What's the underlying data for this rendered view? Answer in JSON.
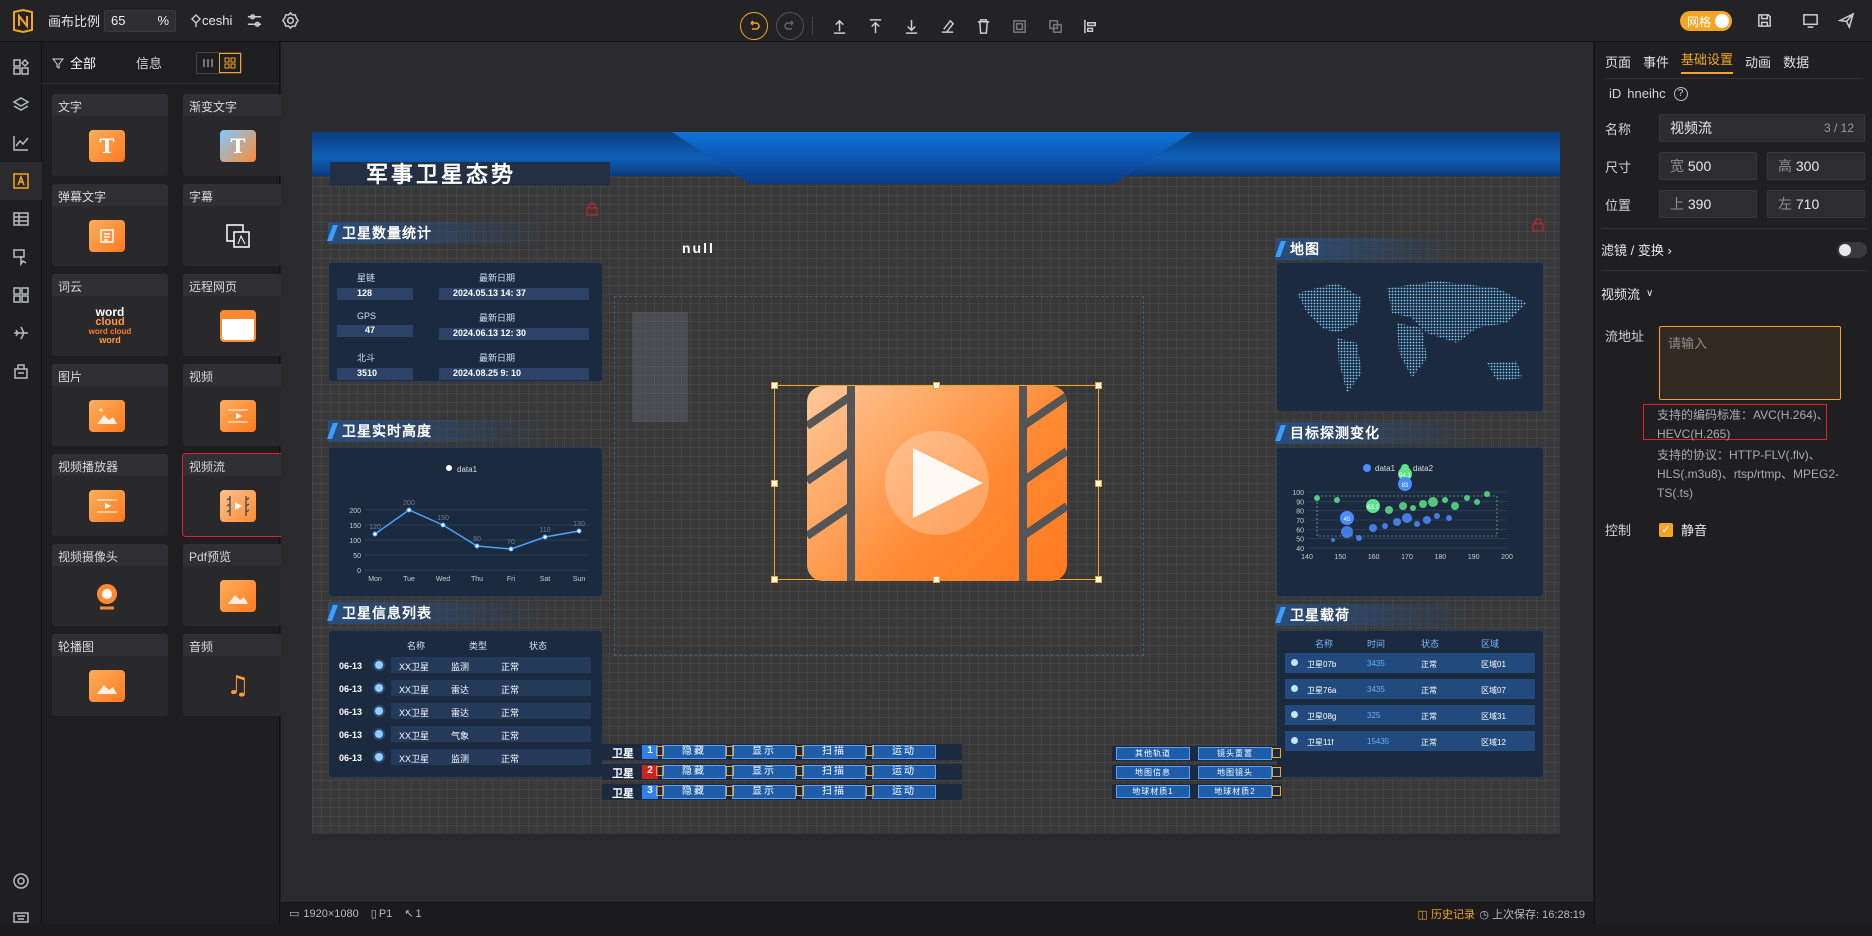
{
  "topbar": {
    "scale_label": "画布比例",
    "scale_value": "65",
    "scale_unit": "%",
    "project": "ceshi",
    "grid_label": "网格"
  },
  "panel": {
    "tab_all": "全部",
    "tab_info": "信息",
    "components": [
      {
        "label": "文字",
        "icon": "text-icon"
      },
      {
        "label": "渐变文字",
        "icon": "gradient-text-icon"
      },
      {
        "label": "弹幕文字",
        "icon": "danmaku-icon"
      },
      {
        "label": "字幕",
        "icon": "subtitle-icon"
      },
      {
        "label": "词云",
        "icon": "wordcloud-icon"
      },
      {
        "label": "远程网页",
        "icon": "webpage-icon"
      },
      {
        "label": "图片",
        "icon": "image-icon"
      },
      {
        "label": "视频",
        "icon": "video-icon"
      },
      {
        "label": "视频播放器",
        "icon": "video-player-icon"
      },
      {
        "label": "视频流",
        "icon": "video-stream-icon"
      },
      {
        "label": "视频摄像头",
        "icon": "camera-icon"
      },
      {
        "label": "Pdf预览",
        "icon": "pdf-icon"
      },
      {
        "label": "轮播图",
        "icon": "carousel-icon"
      },
      {
        "label": "音频",
        "icon": "audio-icon"
      }
    ],
    "wordcloud_text": "word\ncloud\nword cloud\nword"
  },
  "stage": {
    "title": "军事卫星态势",
    "null_text": "null",
    "stats": {
      "title": "卫星数量统计",
      "items": [
        {
          "name": "星链",
          "value": "128",
          "date_label": "最新日期",
          "date": "2024.05.13  14: 37"
        },
        {
          "name": "GPS",
          "value": "47",
          "date_label": "最新日期",
          "date": "2024.06.13  12: 30"
        },
        {
          "name": "北斗",
          "value": "3510",
          "date_label": "最新日期",
          "date": "2024.08.25  9: 10"
        }
      ]
    },
    "altitude": {
      "title": "卫星实时高度",
      "legend": "data1",
      "yticks": [
        "200",
        "150",
        "100",
        "50",
        "0"
      ],
      "days": [
        "Mon",
        "Tue",
        "Wed",
        "Thu",
        "Fri",
        "Sat",
        "Sun"
      ],
      "values": [
        120,
        200,
        150,
        80,
        70,
        110,
        130
      ]
    },
    "list": {
      "title": "卫星信息列表",
      "headers": [
        "名称",
        "类型",
        "状态"
      ],
      "rows": [
        {
          "date": "06-13",
          "name": "XX卫星",
          "type": "监测",
          "status": "正常"
        },
        {
          "date": "06-13",
          "name": "XX卫星",
          "type": "雷达",
          "status": "正常"
        },
        {
          "date": "06-13",
          "name": "XX卫星",
          "type": "雷达",
          "status": "正常"
        },
        {
          "date": "06-13",
          "name": "XX卫星",
          "type": "气象",
          "status": "正常"
        },
        {
          "date": "06-13",
          "name": "XX卫星",
          "type": "监测",
          "status": "正常"
        }
      ]
    },
    "map": {
      "title": "地图"
    },
    "detect": {
      "title": "目标探测变化",
      "legend": [
        "data1",
        "data2"
      ],
      "yticks": [
        "100",
        "90",
        "80",
        "70",
        "60",
        "50",
        "40"
      ],
      "xticks": [
        "140",
        "150",
        "160",
        "170",
        "180",
        "190",
        "200"
      ],
      "labels": [
        "94.1",
        "83",
        "63.2",
        "45"
      ]
    },
    "payload": {
      "title": "卫星载荷",
      "headers": [
        "名称",
        "时间",
        "状态",
        "区域"
      ],
      "rows": [
        {
          "name": "卫星07b",
          "time": "3435",
          "status": "正常",
          "area": "区域01"
        },
        {
          "name": "卫星76a",
          "time": "3435",
          "status": "正常",
          "area": "区域07"
        },
        {
          "name": "卫星08g",
          "time": "325",
          "status": "正常",
          "area": "区域31"
        },
        {
          "name": "卫星11f",
          "time": "15435",
          "status": "正常",
          "area": "区域12"
        }
      ]
    },
    "controls": {
      "label": "卫星",
      "nums": [
        "1",
        "2",
        "3"
      ],
      "buttons": [
        "隐藏",
        "显示",
        "扫描",
        "运动"
      ]
    },
    "controls2": [
      [
        "其他轨道",
        "镜头重置"
      ],
      [
        "地图信息",
        "地图镜头"
      ],
      [
        "地球材质1",
        "地球材质2"
      ]
    ]
  },
  "right": {
    "tabs": [
      "页面",
      "事件",
      "基础设置",
      "动画",
      "数据"
    ],
    "id_label": "iD",
    "id_value": "hneihc",
    "name_label": "名称",
    "name_value": "视频流",
    "name_count": "3 / 12",
    "size_label": "尺寸",
    "width_prefix": "宽",
    "width": "500",
    "height_prefix": "高",
    "height": "300",
    "pos_label": "位置",
    "top_prefix": "上",
    "top": "390",
    "left_prefix": "左",
    "left": "710",
    "filter_label": "滤镜 / 变换",
    "section": "视频流",
    "url_label": "流地址",
    "url_placeholder": "请输入",
    "codec_note": "支持的编码标准：AVC(H.264)、HEVC(H.265)",
    "proto_note": "支持的协议：HTTP-FLV(.flv)、HLS(.m3u8)、rtsp/rtmp、MPEG2-TS(.ts)",
    "control_label": "控制",
    "mute_label": "静音"
  },
  "status": {
    "resolution": "1920×1080",
    "page": "P1",
    "count": "1",
    "history": "历史记录",
    "saved": "上次保存: 16:28:19"
  }
}
